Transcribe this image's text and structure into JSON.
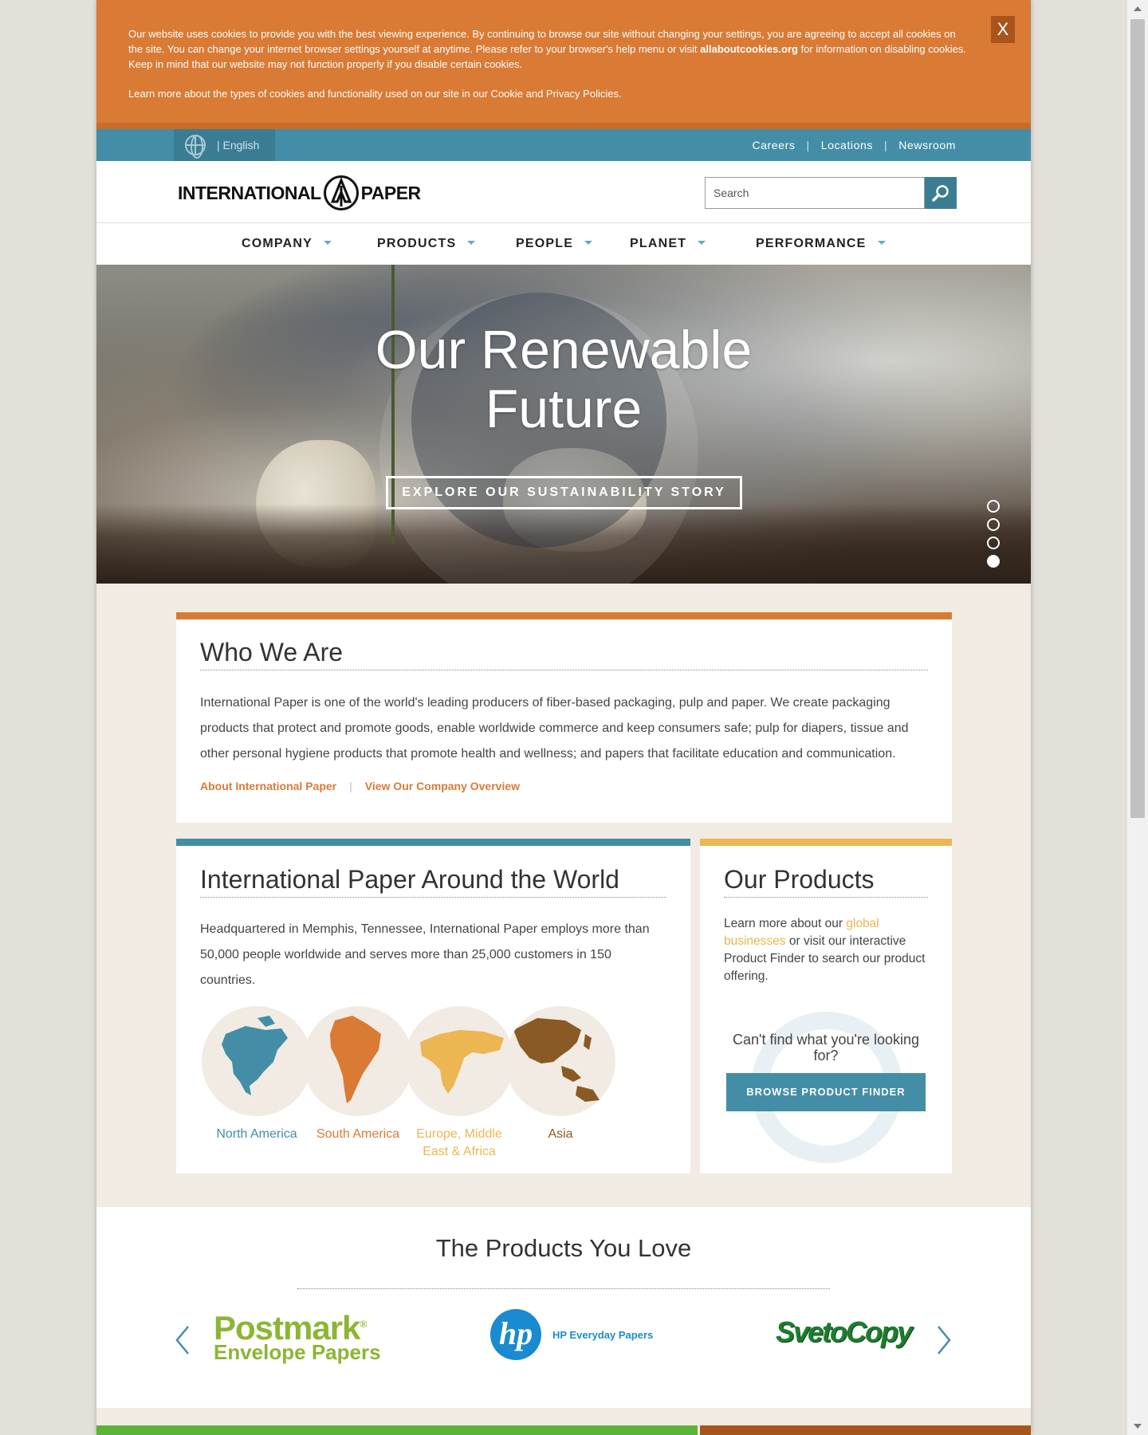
{
  "cookie": {
    "text_1": "Our website uses cookies to provide you with the best viewing experience. By continuing to browse our site without changing your settings, you are agreeing to accept all cookies on the site. You can change your internet browser settings yourself at anytime. Please refer to your browser's help menu or visit ",
    "link": "allaboutcookies.org",
    "text_2": " for information on disabling cookies. Keep in mind that our website may not function properly if you disable certain cookies.",
    "text_3": "Learn more about the types of cookies and functionality used on our site in our Cookie and Privacy Policies.",
    "close_label": "X"
  },
  "utility": {
    "language": "| English",
    "links": [
      "Careers",
      "Locations",
      "Newsroom"
    ],
    "separator": "|"
  },
  "header": {
    "logo_left": "INTERNATIONAL",
    "logo_right": "PAPER",
    "search_placeholder": "Search"
  },
  "nav": {
    "items": [
      "COMPANY",
      "PRODUCTS",
      "PEOPLE",
      "PLANET",
      "PERFORMANCE"
    ]
  },
  "hero": {
    "title_line1": "Our Renewable",
    "title_line2": "Future",
    "button": "EXPLORE OUR SUSTAINABILITY STORY",
    "slides_count": 4,
    "active_slide": 4
  },
  "who": {
    "title": "Who We Are",
    "body": "International Paper is one of the world's leading producers of fiber-based packaging, pulp and paper. We create packaging products that protect and promote goods, enable worldwide commerce and keep consumers safe; pulp for diapers, tissue and other personal hygiene products that promote health and wellness; and papers that facilitate education and communication.",
    "link_1": "About International Paper",
    "link_2": "View Our Company Overview",
    "separator": "|"
  },
  "world": {
    "title": "International Paper Around the World",
    "body": "Headquartered in Memphis, Tennessee, International Paper employs more than 50,000 people worldwide and serves more than 25,000 customers in 150 countries.",
    "regions": [
      {
        "label": "North America",
        "color": "#438ea6"
      },
      {
        "label": "South America",
        "color": "#d97a35"
      },
      {
        "label": "Europe, Middle East & Africa",
        "color": "#ecb652"
      },
      {
        "label": "Asia",
        "color": "#8a5a24"
      }
    ]
  },
  "products_card": {
    "title": "Our Products",
    "body_1": "Learn more about our ",
    "body_link": "global businesses",
    "body_2": " or visit our interactive Product Finder to search our product offering.",
    "cant_find": "Can't find what you're looking for?",
    "button": "BROWSE PRODUCT FINDER"
  },
  "love": {
    "title": "The Products You Love",
    "brands": {
      "postmark_big": "Postmark",
      "postmark_reg": "®",
      "postmark_small": "Envelope Papers",
      "hp_logo": "hp",
      "hp_text": "HP Everyday Papers",
      "sveto": "SvetoCopy"
    }
  },
  "colors": {
    "orange": "#d97a35",
    "teal": "#438ea6",
    "gold": "#ecb652",
    "brown": "#8a5a24",
    "green": "#5cb338"
  }
}
